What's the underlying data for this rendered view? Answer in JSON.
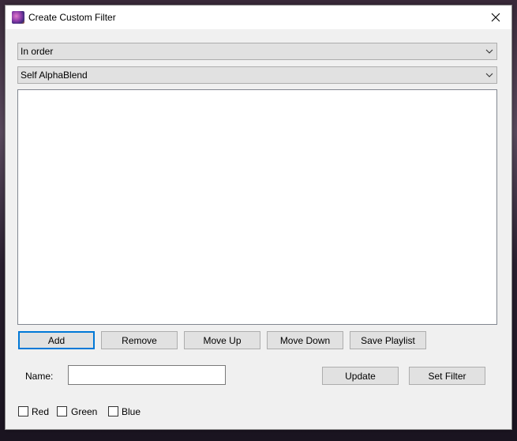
{
  "window": {
    "title": "Create Custom Filter",
    "icon": "app-icon"
  },
  "combos": {
    "order": {
      "value": "In order"
    },
    "blend": {
      "value": "Self AlphaBlend"
    }
  },
  "buttons": {
    "add": "Add",
    "remove": "Remove",
    "move_up": "Move Up",
    "move_down": "Move Down",
    "save_playlist": "Save Playlist",
    "update": "Update",
    "set_filter": "Set Filter"
  },
  "name_field": {
    "label": "Name:",
    "value": ""
  },
  "channels": [
    {
      "label": "Red",
      "checked": false
    },
    {
      "label": "Green",
      "checked": false
    },
    {
      "label": "Blue",
      "checked": false
    }
  ],
  "colors": {
    "default_button_border": "#0078d7",
    "control_face": "#e1e1e1",
    "window_bg": "#f0f0f0"
  }
}
